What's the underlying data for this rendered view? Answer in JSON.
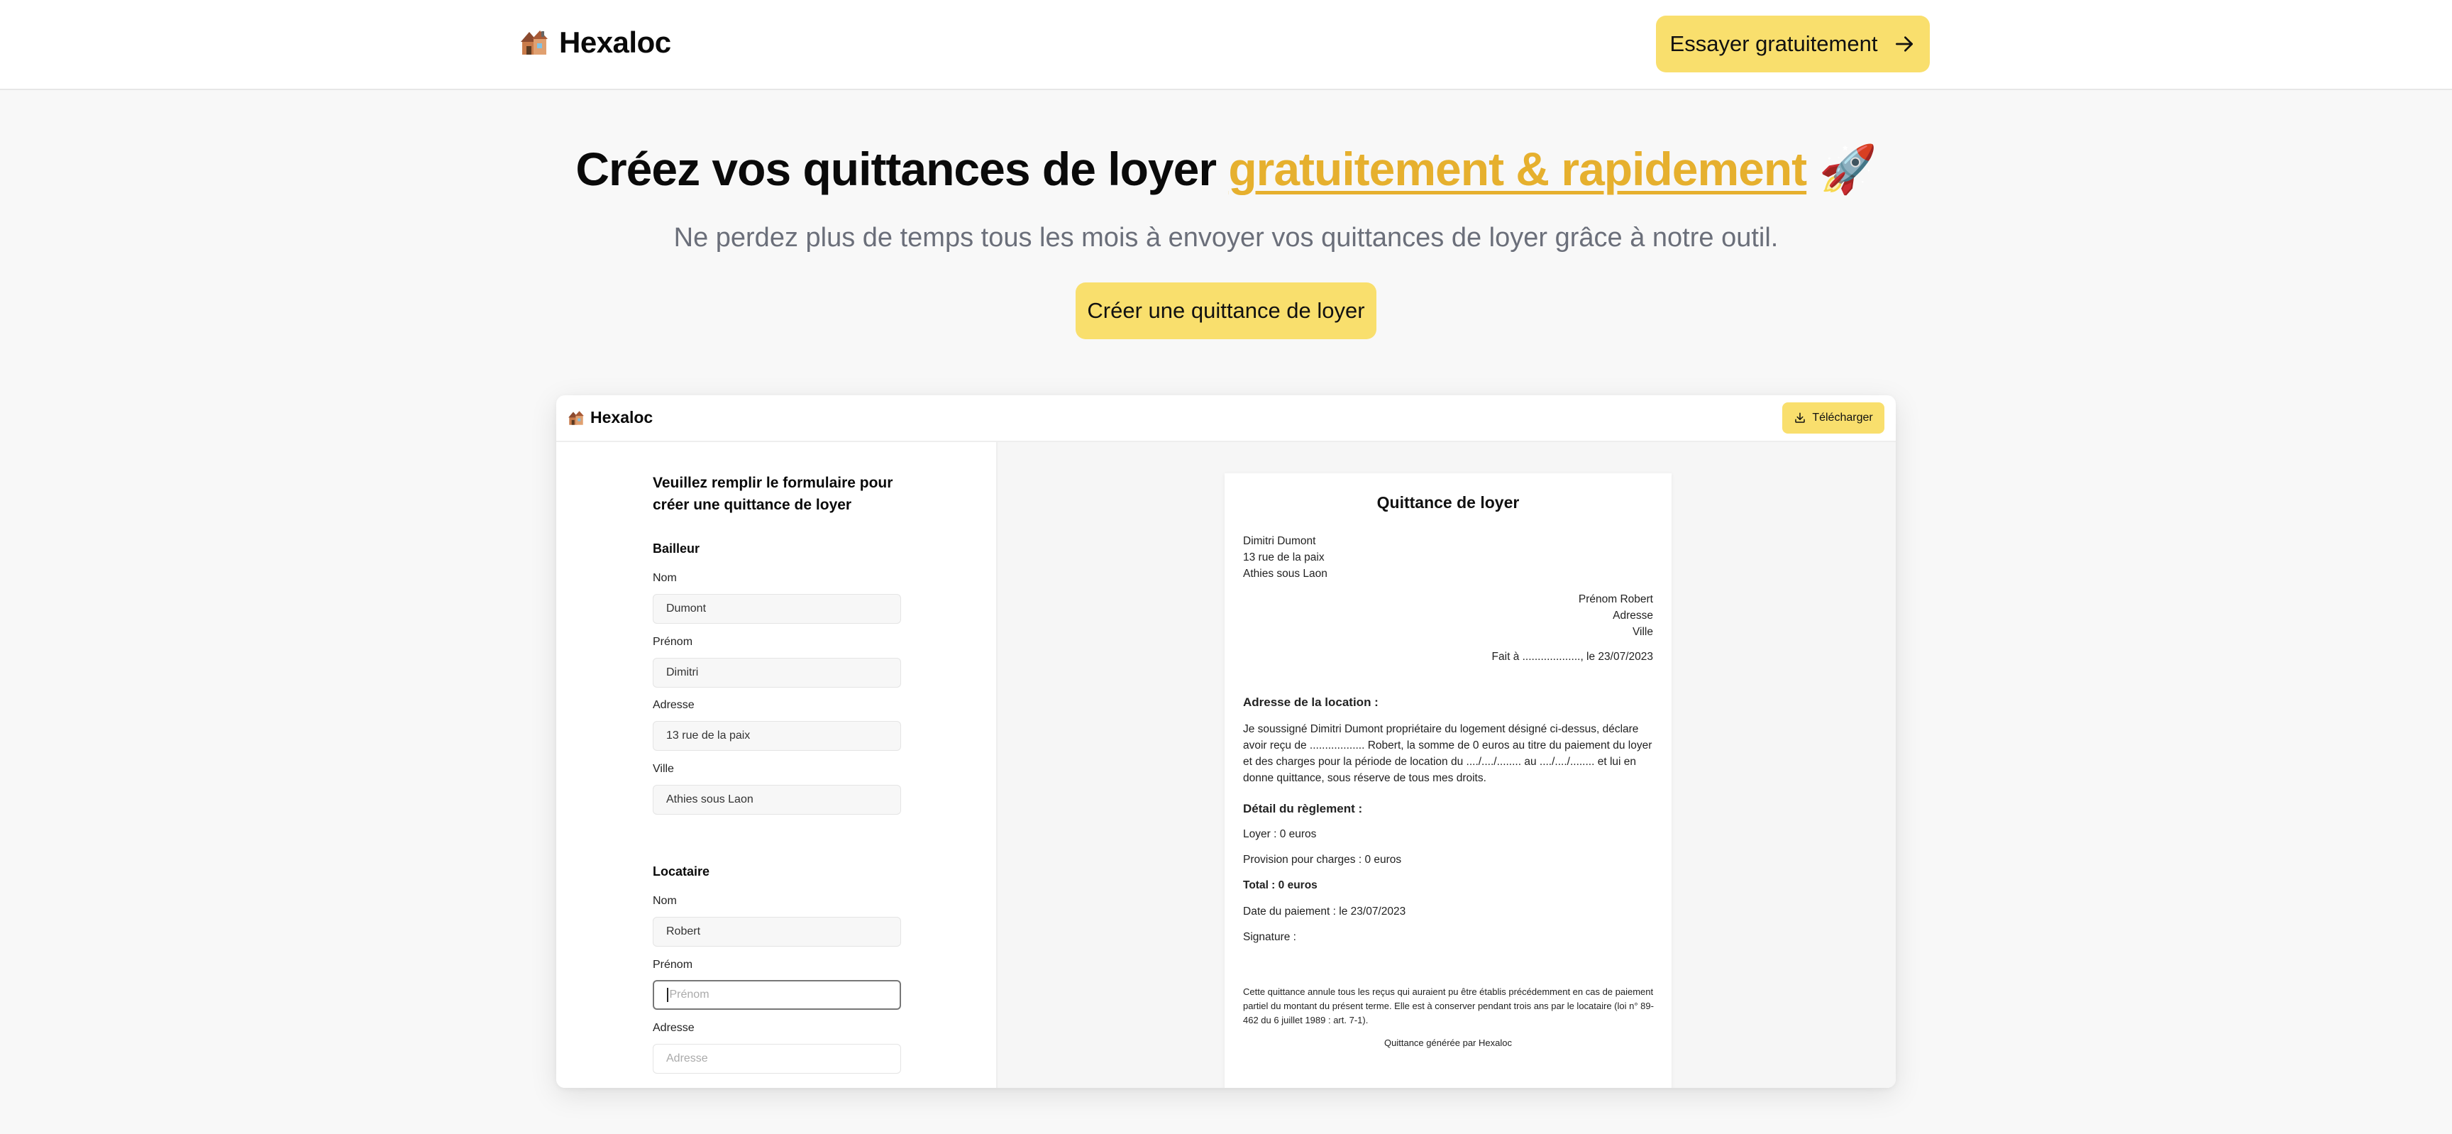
{
  "nav": {
    "brand": "Hexaloc",
    "logo_icon": "house-icon",
    "cta_label": "Essayer gratuitement",
    "cta_icon": "arrow-right-icon",
    "accent_color": "#f9df6d"
  },
  "hero": {
    "title_prefix": "Créez vos quittances de loyer ",
    "title_accent": "gratuitement & rapidement",
    "title_emoji": "🚀",
    "subtitle": "Ne perdez plus de temps tous les mois à envoyer vos quittances de loyer grâce à notre outil.",
    "button_label": "Créer une quittance de loyer",
    "accent_text_color": "#e6b02e"
  },
  "app": {
    "brand": "Hexaloc",
    "download_label": "Télécharger",
    "download_icon": "download-icon",
    "form": {
      "title": "Veuillez remplir le formulaire pour créer une quittance de loyer",
      "bailleur": {
        "heading": "Bailleur",
        "nom_label": "Nom",
        "nom_value": "Dumont",
        "prenom_label": "Prénom",
        "prenom_value": "Dimitri",
        "adresse_label": "Adresse",
        "adresse_value": "13 rue de la paix",
        "ville_label": "Ville",
        "ville_value": "Athies sous Laon"
      },
      "locataire": {
        "heading": "Locataire",
        "nom_label": "Nom",
        "nom_value": "Robert",
        "prenom_label": "Prénom",
        "prenom_placeholder": "Prénom",
        "adresse_label": "Adresse",
        "adresse_placeholder": "Adresse"
      }
    },
    "receipt": {
      "title": "Quittance de loyer",
      "landlord_name": "Dimitri Dumont",
      "landlord_address": "13 rue de la paix",
      "landlord_city": "Athies sous Laon",
      "tenant_name": "Prénom Robert",
      "tenant_address": "Adresse",
      "tenant_city": "Ville",
      "made_at": "Fait à ..................., le 23/07/2023",
      "location_heading": "Adresse de la location :",
      "body": "Je soussigné Dimitri Dumont propriétaire du logement désigné ci-dessus, déclare avoir reçu de .................. Robert, la somme de 0 euros au titre du paiement du loyer et des charges pour la période de location du ..../..../........ au ..../..../........ et lui en donne quittance, sous réserve de tous mes droits.",
      "detail_heading": "Détail du règlement :",
      "loyer": "Loyer : 0 euros",
      "provision": "Provision pour charges : 0 euros",
      "total": "Total : 0 euros",
      "date_paiement": "Date du paiement : le 23/07/2023",
      "signature": "Signature :",
      "footnote": "Cette quittance annule tous les reçus qui auraient pu être établis précédemment en cas de paiement partiel du montant du présent terme. Elle est à conserver pendant trois ans par le locataire (loi n° 89-462 du 6 juillet 1989 : art. 7-1).",
      "generated_by": "Quittance générée par Hexaloc"
    }
  }
}
